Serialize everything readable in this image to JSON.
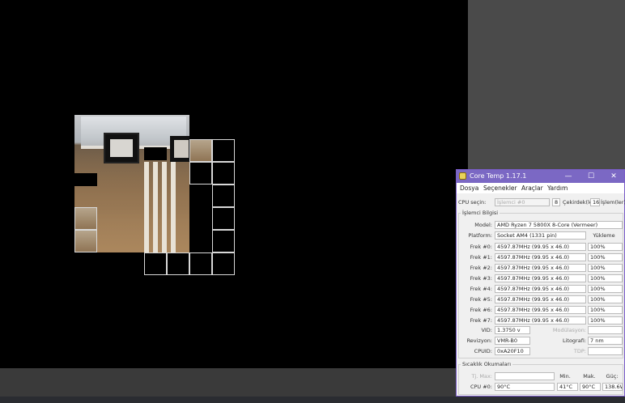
{
  "coretemp": {
    "title": "Core Temp 1.17.1",
    "window_controls": {
      "minimize": "—",
      "maximize": "☐",
      "close": "✕"
    },
    "menu": [
      "Dosya",
      "Seçenekler",
      "Araçlar",
      "Yardım"
    ],
    "cpu_select_label": "CPU seçin:",
    "cpu_select_value": "İşlemci #0",
    "cores_value": "8",
    "cores_label": "Çekirdek(ler)",
    "threads_value": "16",
    "threads_label": "İşlem(ler)",
    "processor_info_title": "İşlemci Bilgisi",
    "model_label": "Model:",
    "model_value": "AMD Ryzen 7 5800X 8-Core (Vermeer)",
    "platform_label": "Platform:",
    "platform_value": "Socket AM4 (1331 pin)",
    "load_header": "Yükleme",
    "freqs": [
      {
        "label": "Frek #0:",
        "value": "4597.87MHz (99.95 x 46.0)",
        "load": "100%"
      },
      {
        "label": "Frek #1:",
        "value": "4597.87MHz (99.95 x 46.0)",
        "load": "100%"
      },
      {
        "label": "Frek #2:",
        "value": "4597.87MHz (99.95 x 46.0)",
        "load": "100%"
      },
      {
        "label": "Frek #3:",
        "value": "4597.87MHz (99.95 x 46.0)",
        "load": "100%"
      },
      {
        "label": "Frek #4:",
        "value": "4597.87MHz (99.95 x 46.0)",
        "load": "100%"
      },
      {
        "label": "Frek #5:",
        "value": "4597.87MHz (99.95 x 46.0)",
        "load": "100%"
      },
      {
        "label": "Frek #6:",
        "value": "4597.87MHz (99.95 x 46.0)",
        "load": "100%"
      },
      {
        "label": "Frek #7:",
        "value": "4597.87MHz (99.95 x 46.0)",
        "load": "100%"
      }
    ],
    "vid_label": "VID:",
    "vid_value": "1.3750 v",
    "modulation_label": "Modülasyon:",
    "revision_label": "Revizyon:",
    "revision_value": "VMR-B0",
    "lithography_label": "Litografi:",
    "lithography_value": "7 nm",
    "cpuid_label": "CPUID:",
    "cpuid_value": "0xA20F10",
    "tdp_label": "TDP:",
    "temp_title": "Sıcaklık Okumaları",
    "tjmax_label": "Tj. Max:",
    "min_header": "Min.",
    "max_header": "Mak.",
    "power_header": "Güç:",
    "cpu0_label": "CPU #0:",
    "cpu0_temp": "90°C",
    "cpu0_min": "41°C",
    "cpu0_max": "90°C",
    "cpu0_power": "138.6W"
  }
}
